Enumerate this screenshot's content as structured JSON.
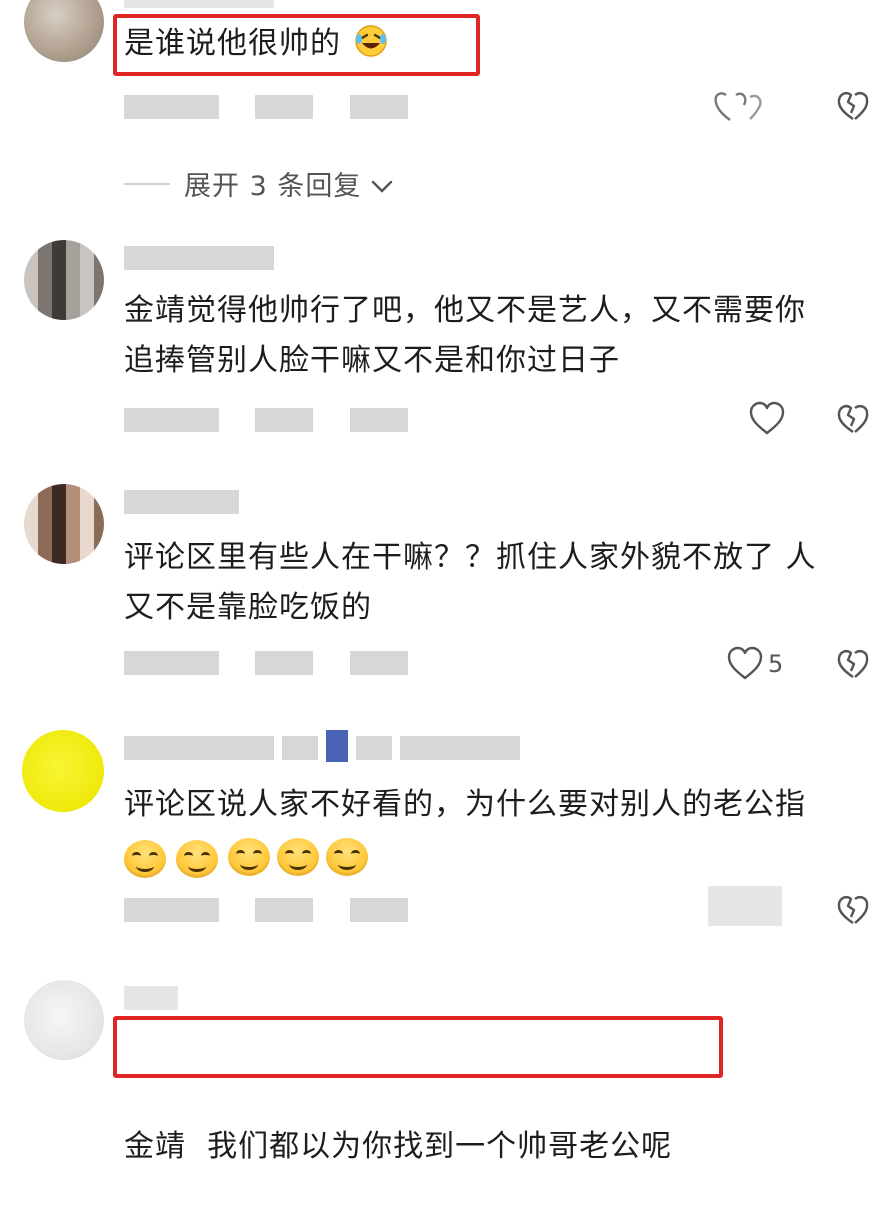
{
  "comments": [
    {
      "text": "是谁说他很帅的",
      "emoji": "rofl-emoji",
      "highlighted": true
    },
    {
      "text_lines": [
        "金靖觉得他帅行了吧，他又不是艺人，又不需要你",
        "追捧管别人脸干嘛又不是和你过日子"
      ]
    },
    {
      "text_lines": [
        "评论区里有些人在干嘛？？抓住人家外貌不放了 人",
        "又不是靠脸吃饭的"
      ],
      "like_count": "5"
    },
    {
      "text": "评论区说人家不好看的，为什么要对别人的老公指",
      "emojis": [
        "smirk-emoji",
        "smirk-emoji",
        "smile-emoji",
        "smile-emoji",
        "smile-emoji"
      ]
    },
    {
      "text": "金靖  我们都以为你找到一个帅哥老公呢",
      "highlighted": true
    }
  ],
  "expand_replies": {
    "label": "展开 3 条回复"
  },
  "colors": {
    "highlight_box": "#e02525",
    "avatar_yellow": "#efe90a"
  },
  "icons": {
    "like": "heart-outline-icon",
    "dislike": "broken-heart-icon",
    "expand": "chevron-down-icon"
  }
}
